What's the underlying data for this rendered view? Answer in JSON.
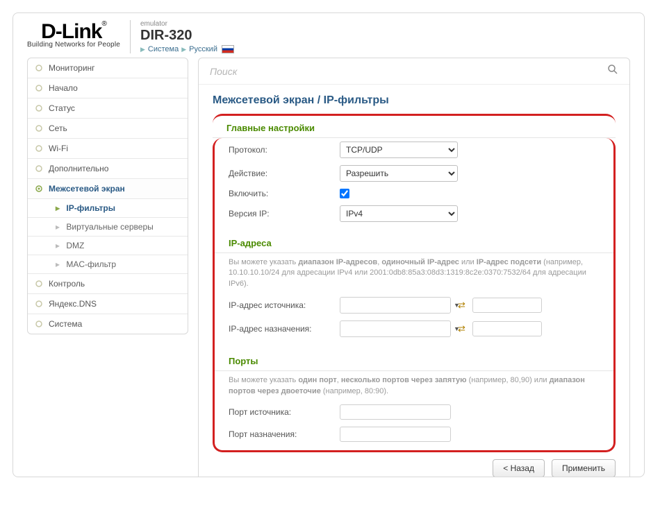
{
  "header": {
    "logo_brand": "D-Link",
    "logo_tag": "Building Networks for People",
    "emulator": "emulator",
    "model": "DIR-320",
    "crumb1": "Система",
    "crumb2": "Русский"
  },
  "sidebar": {
    "items": [
      {
        "label": "Мониторинг"
      },
      {
        "label": "Начало"
      },
      {
        "label": "Статус"
      },
      {
        "label": "Сеть"
      },
      {
        "label": "Wi-Fi"
      },
      {
        "label": "Дополнительно"
      },
      {
        "label": "Межсетевой экран"
      },
      {
        "label": "Контроль"
      },
      {
        "label": "Яндекс.DNS"
      },
      {
        "label": "Система"
      }
    ],
    "sub": [
      {
        "label": "IP-фильтры"
      },
      {
        "label": "Виртуальные серверы"
      },
      {
        "label": "DMZ"
      },
      {
        "label": "MAC-фильтр"
      }
    ]
  },
  "search": {
    "placeholder": "Поиск"
  },
  "title": {
    "part1": "Межсетевой экран",
    "sep": "/",
    "part2": "IP-фильтры"
  },
  "sections": {
    "main": {
      "header": "Главные настройки",
      "protocol_label": "Протокол:",
      "protocol_value": "TCP/UDP",
      "action_label": "Действие:",
      "action_value": "Разрешить",
      "enable_label": "Включить:",
      "ipver_label": "Версия IP:",
      "ipver_value": "IPv4"
    },
    "ip": {
      "header": "IP-адреса",
      "hint_pre": "Вы можете указать ",
      "hint_b1": "диапазон IP-адресов",
      "hint_mid1": ", ",
      "hint_b2": "одиночный IP-адрес",
      "hint_mid2": " или ",
      "hint_b3": "IP-адрес подсети",
      "hint_post": " (например, 10.10.10.10/24 для адресации IPv4 или 2001:0db8:85a3:08d3:1319:8c2e:0370:7532/64 для адресации IPv6).",
      "src_label": "IP-адрес источника:",
      "dst_label": "IP-адрес назначения:"
    },
    "ports": {
      "header": "Порты",
      "hint_pre": "Вы можете указать ",
      "hint_b1": "один порт",
      "hint_mid1": ", ",
      "hint_b2": "несколько портов через запятую",
      "hint_mid2": " (например, 80,90) или ",
      "hint_b3": "диапазон портов через двоеточие",
      "hint_post": " (например, 80:90).",
      "src_label": "Порт источника:",
      "dst_label": "Порт назначения:"
    }
  },
  "buttons": {
    "back": "< Назад",
    "apply": "Применить"
  }
}
